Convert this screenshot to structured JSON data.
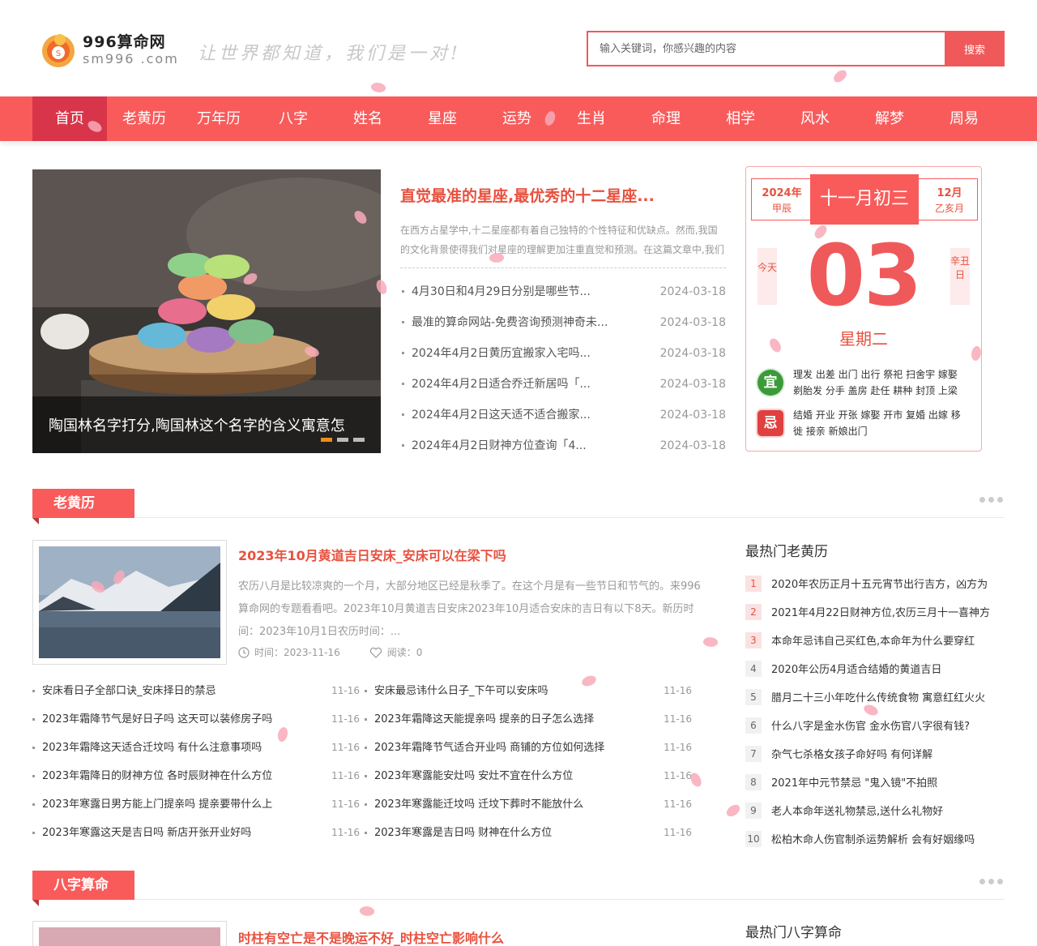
{
  "logo": {
    "name": "996算命网",
    "domain": "sm996 .com"
  },
  "slogan": "让世界都知道，我们是一对!",
  "search": {
    "placeholder": "输入关键词，你感兴趣的内容",
    "button": "搜索"
  },
  "nav": [
    "首页",
    "老黄历",
    "万年历",
    "八字",
    "姓名",
    "星座",
    "运势",
    "生肖",
    "命理",
    "相学",
    "风水",
    "解梦",
    "周易"
  ],
  "carousel": {
    "caption": "陶国林名字打分,陶国林这个名字的含义寓意怎"
  },
  "headline": {
    "title": "直觉最准的星座,最优秀的十二星座...",
    "summary": "在西方占星学中,十二星座都有着自己独特的个性特征和优缺点。然而,我国的文化背景使得我们对星座的理解更加注重直觉和预测。在这篇文章中,我们",
    "items": [
      {
        "title": "4月30日和4月29日分别是哪些节...",
        "date": "2024-03-18"
      },
      {
        "title": "最准的算命网站-免费咨询预测神奇未...",
        "date": "2024-03-18"
      },
      {
        "title": "2024年4月2日黄历宜搬家入宅吗...",
        "date": "2024-03-18"
      },
      {
        "title": "2024年4月2日适合乔迁新居吗「...",
        "date": "2024-03-18"
      },
      {
        "title": "2024年4月2日这天适不适合搬家...",
        "date": "2024-03-18"
      },
      {
        "title": "2024年4月2日财神方位查询「4...",
        "date": "2024-03-18"
      }
    ]
  },
  "calendar": {
    "year": "2024年",
    "year_sub": "甲辰",
    "lunar": "十一月初三",
    "month": "12月",
    "month_sub": "乙亥月",
    "today": "今天",
    "ganzhi": "辛丑日",
    "day": "03",
    "weekday": "星期二",
    "yi_label": "宜",
    "yi": "理发 出差 出门 出行 祭祀 扫舍宇 嫁娶 剃胎发 分手 盖房 赴任 耕种 封顶 上梁",
    "ji_label": "忌",
    "ji": "结婚 开业 开张 嫁娶 开市 复婚 出嫁 移徙 接亲 新娘出门"
  },
  "section1": {
    "title": "老黄历",
    "feature": {
      "title": "2023年10月黄道吉日安床_安床可以在梁下吗",
      "summary": "农历八月是比较凉爽的一个月，大部分地区已经是秋季了。在这个月是有一些节日和节气的。来996算命网的专题看看吧。2023年10月黄道吉日安床2023年10月适合安床的吉日有以下8天。新历时间：2023年10月1日农历时间：...",
      "time": "时间：2023-11-16",
      "reads": "阅读：0"
    },
    "list": [
      {
        "title": "安床看日子全部口诀_安床择日的禁忌",
        "date": "11-16"
      },
      {
        "title": "安床最忌讳什么日子_下午可以安床吗",
        "date": "11-16"
      },
      {
        "title": "2023年霜降节气是好日子吗 这天可以装修房子吗",
        "date": "11-16"
      },
      {
        "title": "2023年霜降这天能提亲吗 提亲的日子怎么选择",
        "date": "11-16"
      },
      {
        "title": "2023年霜降这天适合迁坟吗 有什么注意事项吗",
        "date": "11-16"
      },
      {
        "title": "2023年霜降节气适合开业吗 商铺的方位如何选择",
        "date": "11-16"
      },
      {
        "title": "2023年霜降日的财神方位 各时辰财神在什么方位",
        "date": "11-16"
      },
      {
        "title": "2023年寒露能安灶吗 安灶不宜在什么方位",
        "date": "11-16"
      },
      {
        "title": "2023年寒露日男方能上门提亲吗 提亲要带什么上",
        "date": "11-16"
      },
      {
        "title": "2023年寒露能迁坟吗 迁坟下葬时不能放什么",
        "date": "11-16"
      },
      {
        "title": "2023年寒露这天是吉日吗 新店开张开业好吗",
        "date": "11-16"
      },
      {
        "title": "2023年寒露是吉日吗 财神在什么方位",
        "date": "11-16"
      }
    ],
    "hot_title": "最热门老黄历",
    "hot": [
      {
        "n": "1",
        "title": "2020年农历正月十五元宵节出行吉方，凶方为"
      },
      {
        "n": "2",
        "title": "2021年4月22日财神方位,农历三月十一喜神方"
      },
      {
        "n": "3",
        "title": "本命年忌讳自己买红色,本命年为什么要穿红"
      },
      {
        "n": "4",
        "title": "2020年公历4月适合结婚的黄道吉日"
      },
      {
        "n": "5",
        "title": "腊月二十三小年吃什么传统食物 寓意红红火火"
      },
      {
        "n": "6",
        "title": "什么八字是金水伤官 金水伤官八字很有钱?"
      },
      {
        "n": "7",
        "title": "杂气七杀格女孩子命好吗 有何详解"
      },
      {
        "n": "8",
        "title": "2021年中元节禁忌 \"鬼入镜\"不拍照"
      },
      {
        "n": "9",
        "title": "老人本命年送礼物禁忌,送什么礼物好"
      },
      {
        "n": "10",
        "title": "松柏木命人伤官制杀运势解析 会有好姻缘吗"
      }
    ]
  },
  "section2": {
    "title": "八字算命",
    "feature_title": "时柱有空亡是不是晚运不好_时柱空亡影响什么",
    "hot_title": "最热门八字算命"
  },
  "colors": {
    "brand": "#f95b5b",
    "nav_active": "#d9354a",
    "accent_text": "#e8513f"
  }
}
